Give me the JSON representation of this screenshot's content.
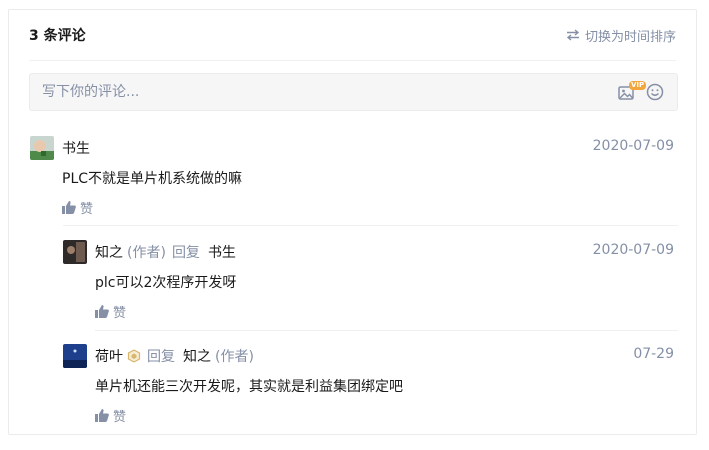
{
  "header": {
    "count_label": "3 条评论",
    "sort_label": "切换为时间排序"
  },
  "editor": {
    "placeholder": "写下你的评论...",
    "vip_badge": "VIP",
    "image_icon": "image-icon",
    "emoji_icon": "emoji-icon"
  },
  "comments": [
    {
      "author": "书生",
      "date": "2020-07-09",
      "content": "PLC不就是单片机系统做的嘛",
      "like_label": "赞"
    },
    {
      "author": "知之",
      "author_role": "(作者)",
      "reply_label": "回复",
      "reply_to": "书生",
      "date": "2020-07-09",
      "content": "plc可以2次程序开发呀",
      "like_label": "赞"
    },
    {
      "author": "荷叶",
      "badge_icon": "member-badge-icon",
      "reply_label": "回复",
      "reply_to": "知之",
      "reply_to_role": "(作者)",
      "date": "07-29",
      "content": "单片机还能三次开发呢，其实就是利益集团绑定吧",
      "like_label": "赞"
    }
  ],
  "colors": {
    "secondary_text": "#8590a6",
    "badge_gold": "#d8b66a",
    "vip_orange": "#f3a63b"
  }
}
